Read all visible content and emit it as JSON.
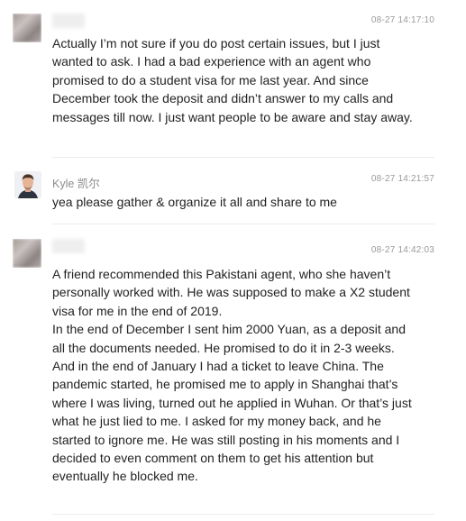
{
  "comments": [
    {
      "author": "",
      "time": "08-27 14:17:10",
      "text": "Actually I’m not sure if you do post certain issues, but I just wanted to ask. I had a bad experience with an agent who promised to do a student visa for me last year. And since December took the deposit and didn’t answer to my calls and messages till now. I just want people to be aware and stay away."
    },
    {
      "author": "Kyle 凯尔",
      "time": "08-27 14:21:57",
      "text": "yea please gather & organize it all and share to me"
    },
    {
      "author": "",
      "time": "08-27 14:42:03",
      "text": "A friend recommended this Pakistani agent, who she haven’t personally worked with. He was supposed to make a X2 student visa for me in the end of 2019.\nIn the end of December I sent him 2000 Yuan, as a deposit and all the documents needed. He promised to do it in 2-3 weeks. And in the end of January I had a ticket to leave China. The pandemic started, he promised me to apply in Shanghai that’s where I was living, turned out he applied in Wuhan. Or that’s just what he just lied to me. I asked for my money back, and he started to ignore me. He was still posting in his moments and I decided to even comment on them to get his attention but eventually he blocked me."
    }
  ]
}
